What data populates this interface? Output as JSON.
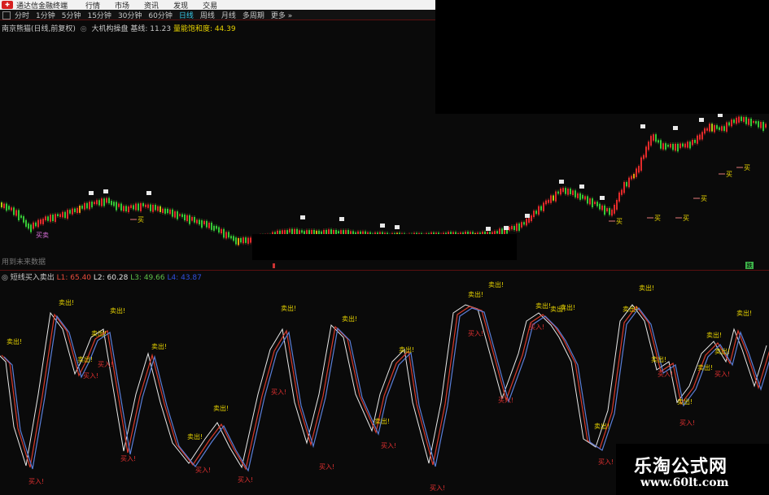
{
  "window": {
    "app_title": "通达信金融终端",
    "menus": [
      "行情",
      "市场",
      "资讯",
      "发现",
      "交易"
    ]
  },
  "periods": {
    "items": [
      "分时",
      "1分钟",
      "5分钟",
      "15分钟",
      "30分钟",
      "60分钟",
      "日线",
      "周线",
      "月线",
      "多周期",
      "更多 »"
    ],
    "active": "日线"
  },
  "main_chart": {
    "stock_name": "南京熊猫(日线,前复权)",
    "indicator": "大机构操盘",
    "base_line_label": "基线: 11.23",
    "saturation_label": "量能饱和度: 44.39",
    "footer_note": "用到未来数据",
    "buy_label": "买",
    "sell_label": "卖"
  },
  "sub_chart": {
    "indicator_name": "短线买入卖出",
    "l1": "L1: 65.40",
    "l2": "L2: 60.28",
    "l3": "L3: 49.66",
    "l4": "L4: 43.87",
    "sell_label": "卖出!",
    "buy_label": "买入!"
  },
  "watermark": {
    "title": "乐淘公式网",
    "url": "www.60lt.com"
  },
  "colors": {
    "up": "#e32b2b",
    "down": "#37c837",
    "yellow": "#e6d200",
    "line_red": "#d83a2a",
    "line_blue": "#5a7fd8",
    "line_white": "#e8e8e8"
  },
  "icons": {
    "logo": "tdx-logo-icon",
    "chart_marker": "circle-marker-icon"
  }
}
